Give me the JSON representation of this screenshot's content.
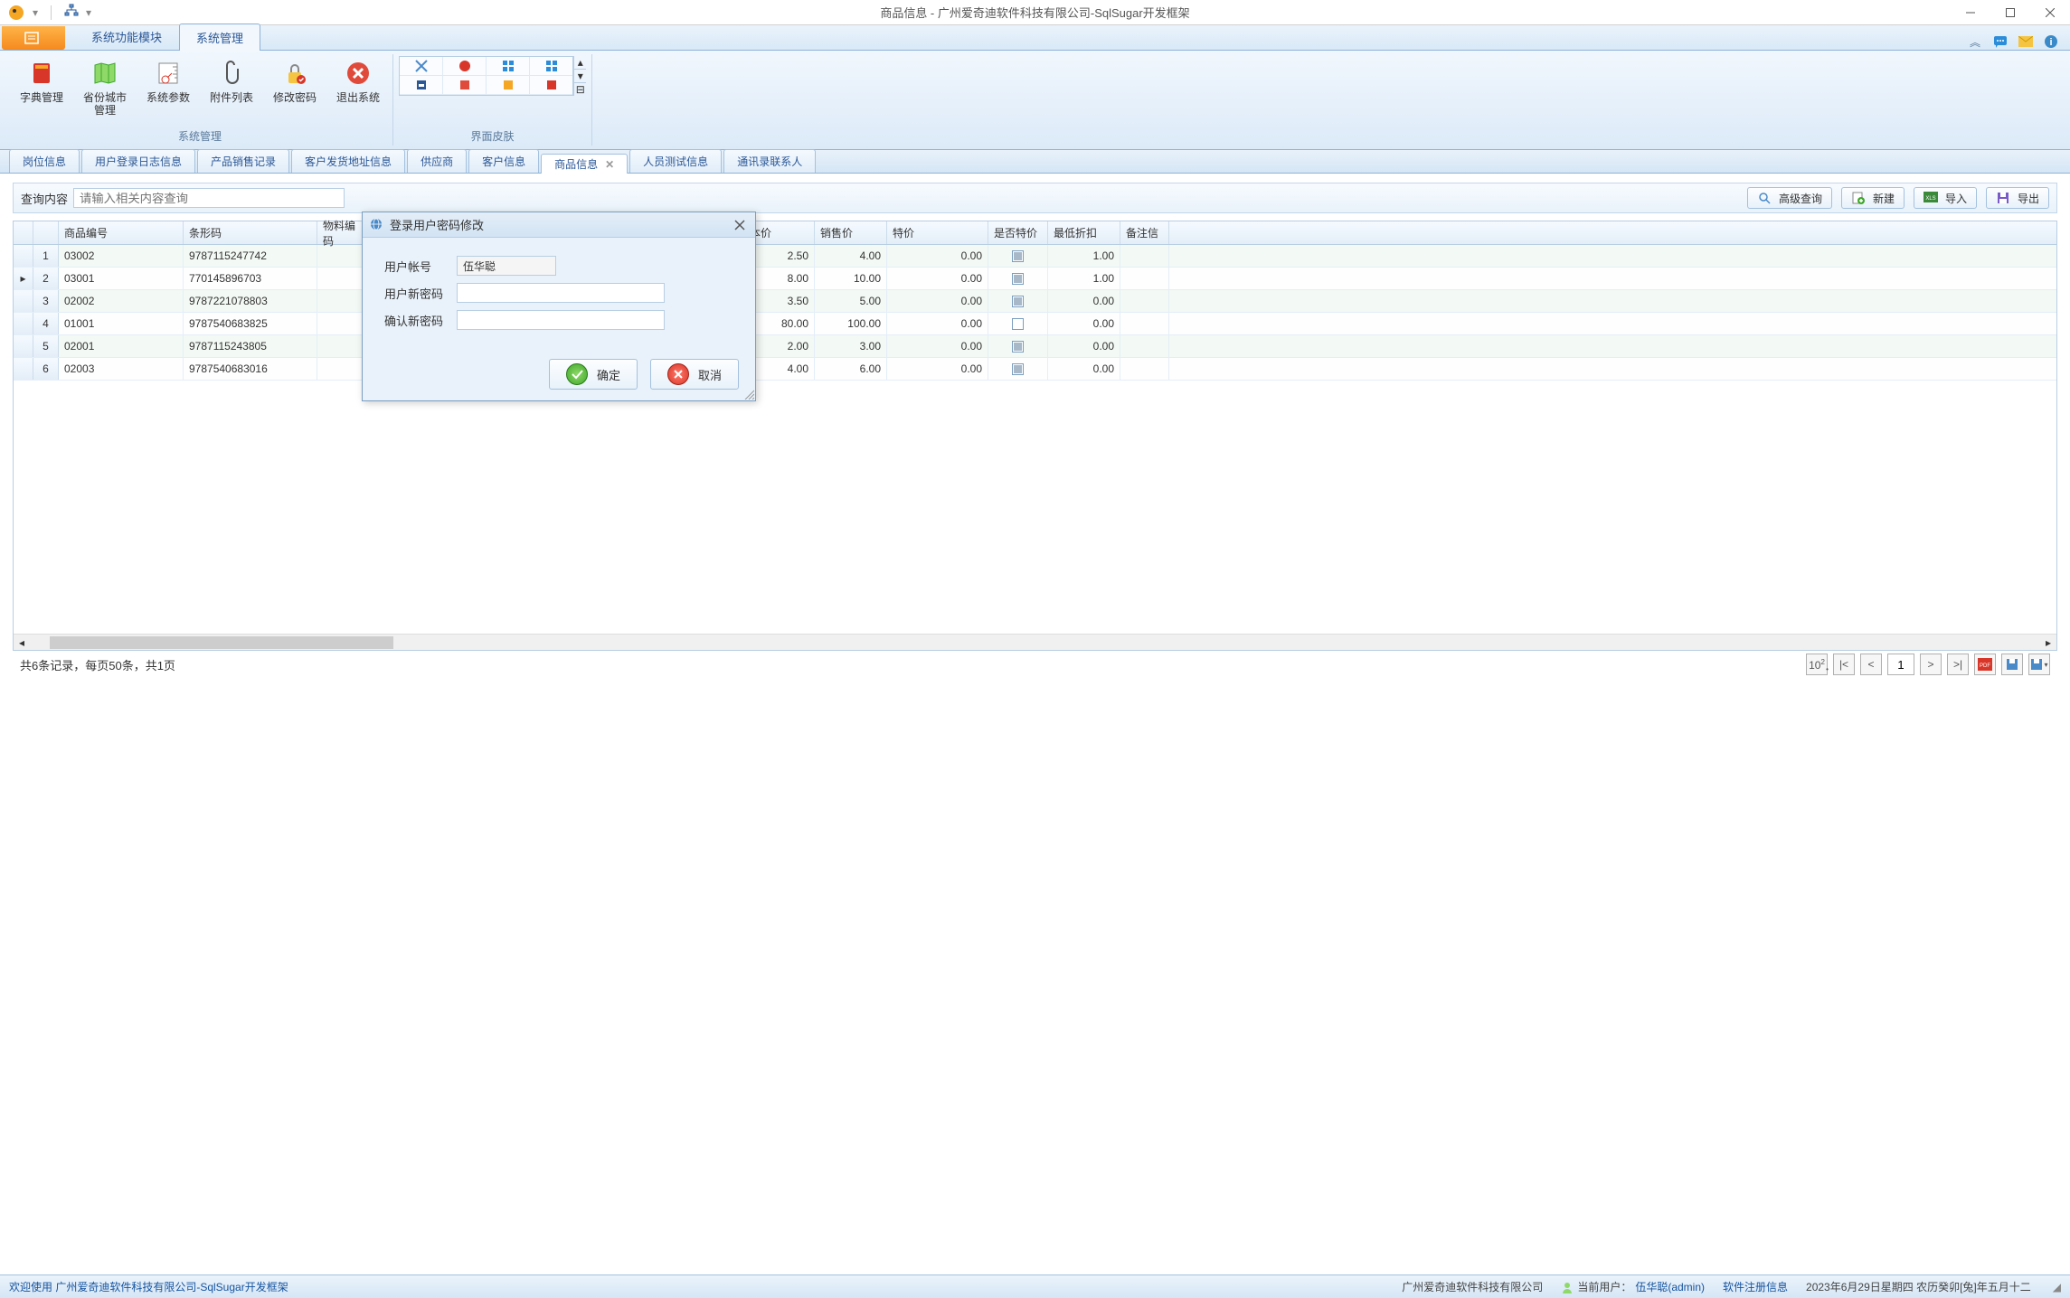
{
  "titlebar": {
    "title": "商品信息 - 广州爱奇迪软件科技有限公司-SqlSugar开发框架"
  },
  "ribbon": {
    "tabs": [
      {
        "label": "系统功能模块",
        "active": false
      },
      {
        "label": "系统管理",
        "active": true
      }
    ],
    "group_system_label": "系统管理",
    "group_skin_label": "界面皮肤",
    "items": [
      {
        "label": "字典管理",
        "icon": "book-icon"
      },
      {
        "label": "省份城市管理",
        "icon": "map-icon"
      },
      {
        "label": "系统参数",
        "icon": "ruler-icon"
      },
      {
        "label": "附件列表",
        "icon": "attachment-icon"
      },
      {
        "label": "修改密码",
        "icon": "lock-icon"
      },
      {
        "label": "退出系统",
        "icon": "exit-icon"
      }
    ]
  },
  "doc_tabs": [
    {
      "label": "岗位信息",
      "active": false
    },
    {
      "label": "用户登录日志信息",
      "active": false
    },
    {
      "label": "产品销售记录",
      "active": false
    },
    {
      "label": "客户发货地址信息",
      "active": false
    },
    {
      "label": "供应商",
      "active": false
    },
    {
      "label": "客户信息",
      "active": false
    },
    {
      "label": "商品信息",
      "active": true,
      "closable": true
    },
    {
      "label": "人员测试信息",
      "active": false
    },
    {
      "label": "通讯录联系人",
      "active": false
    }
  ],
  "search": {
    "label": "查询内容",
    "placeholder": "请输入相关内容查询"
  },
  "toolbar": {
    "advanced_query": "高级查询",
    "new": "新建",
    "import": "导入",
    "export": "导出"
  },
  "grid": {
    "headers": {
      "product_code": "商品编号",
      "barcode": "条形码",
      "material_code": "物料编码",
      "cost_price": "成本价",
      "sale_price": "销售价",
      "special_price": "特价",
      "is_special": "是否特价",
      "min_discount": "最低折扣",
      "remark": "备注信"
    },
    "rows": [
      {
        "n": "1",
        "code": "03002",
        "barcode": "9787115247742",
        "cost": "2.50",
        "sale": "4.00",
        "special": "0.00",
        "is_sp": true,
        "disc": "1.00"
      },
      {
        "n": "2",
        "code": "03001",
        "barcode": "770145896703",
        "cost": "8.00",
        "sale": "10.00",
        "special": "0.00",
        "is_sp": true,
        "disc": "1.00",
        "cur": true
      },
      {
        "n": "3",
        "code": "02002",
        "barcode": "9787221078803",
        "cost": "3.50",
        "sale": "5.00",
        "special": "0.00",
        "is_sp": true,
        "disc": "0.00"
      },
      {
        "n": "4",
        "code": "01001",
        "barcode": "9787540683825",
        "cost": "80.00",
        "sale": "100.00",
        "special": "0.00",
        "is_sp": false,
        "disc": "0.00"
      },
      {
        "n": "5",
        "code": "02001",
        "barcode": "9787115243805",
        "cost": "2.00",
        "sale": "3.00",
        "special": "0.00",
        "is_sp": true,
        "disc": "0.00"
      },
      {
        "n": "6",
        "code": "02003",
        "barcode": "9787540683016",
        "cost": "4.00",
        "sale": "6.00",
        "special": "0.00",
        "is_sp": true,
        "disc": "0.00"
      }
    ]
  },
  "pagination": {
    "summary": "共6条记录，每页50条，共1页",
    "page": "1",
    "scale": "10²"
  },
  "dialog": {
    "title": "登录用户密码修改",
    "username_label": "用户帐号",
    "username_value": "伍华聪",
    "newpass_label": "用户新密码",
    "confirm_label": "确认新密码",
    "ok": "确定",
    "cancel": "取消"
  },
  "statusbar": {
    "welcome": "欢迎使用 广州爱奇迪软件科技有限公司-SqlSugar开发框架",
    "company": "广州爱奇迪软件科技有限公司",
    "user_label": "当前用户：",
    "user_value": "伍华聪(admin)",
    "reg": "软件注册信息",
    "date": "2023年6月29日星期四 农历癸卯[兔]年五月十二"
  }
}
